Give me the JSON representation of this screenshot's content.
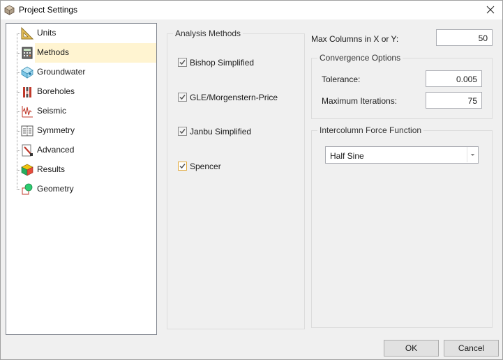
{
  "window": {
    "title": "Project Settings"
  },
  "tree": {
    "items": [
      {
        "label": "Units",
        "icon": "ruler-triangle-icon"
      },
      {
        "label": "Methods",
        "icon": "calculator-icon"
      },
      {
        "label": "Groundwater",
        "icon": "water-drops-icon"
      },
      {
        "label": "Boreholes",
        "icon": "borehole-icon"
      },
      {
        "label": "Seismic",
        "icon": "seismic-wave-icon"
      },
      {
        "label": "Symmetry",
        "icon": "symmetry-icon"
      },
      {
        "label": "Advanced",
        "icon": "advanced-tools-icon"
      },
      {
        "label": "Results",
        "icon": "results-cube-icon"
      },
      {
        "label": "Geometry",
        "icon": "geometry-icon"
      }
    ],
    "selected": "Methods"
  },
  "analysis": {
    "title": "Analysis Methods",
    "methods": [
      {
        "label": "Bishop Simplified",
        "checked": true
      },
      {
        "label": "GLE/Morgenstern-Price",
        "checked": true
      },
      {
        "label": "Janbu Simplified",
        "checked": true
      },
      {
        "label": "Spencer",
        "checked": true
      }
    ]
  },
  "max_columns": {
    "label": "Max Columns in X or Y:",
    "value": "50"
  },
  "convergence": {
    "title": "Convergence Options",
    "tolerance_label": "Tolerance:",
    "tolerance_value": "0.005",
    "iterations_label": "Maximum Iterations:",
    "iterations_value": "75"
  },
  "intercolumn": {
    "title": "Intercolumn Force Function",
    "selected": "Half Sine"
  },
  "buttons": {
    "ok": "OK",
    "cancel": "Cancel"
  },
  "colors": {
    "selection": "#fff4d1",
    "focus_border": "#e2a93a",
    "check": "#333333"
  }
}
